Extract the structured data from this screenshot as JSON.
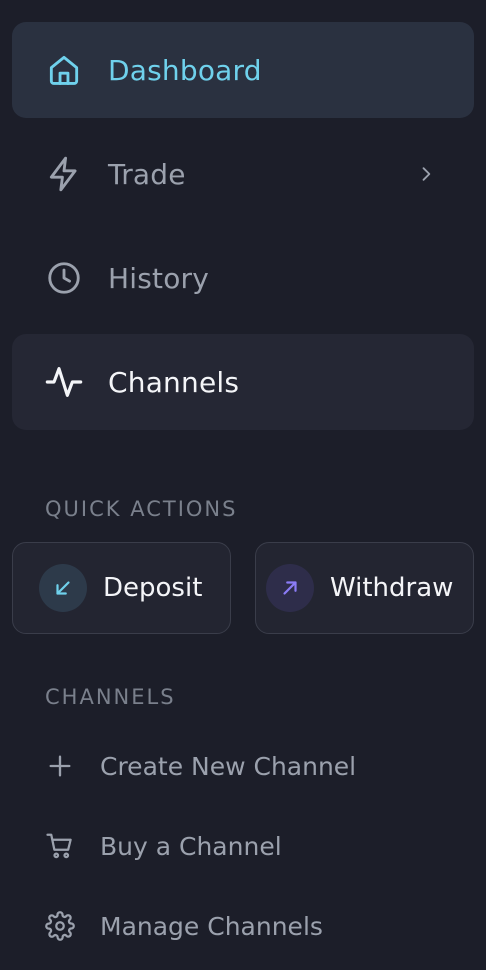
{
  "nav": {
    "dashboard": {
      "label": "Dashboard",
      "icon": "home-icon",
      "active": true,
      "color": "#6fd1ec"
    },
    "trade": {
      "label": "Trade",
      "icon": "lightning-icon",
      "has_submenu": true
    },
    "history": {
      "label": "History",
      "icon": "clock-icon"
    },
    "channels": {
      "label": "Channels",
      "icon": "activity-icon",
      "highlighted": true
    }
  },
  "quick_actions": {
    "heading": "QUICK ACTIONS",
    "deposit": {
      "label": "Deposit",
      "icon": "arrow-down-left-icon",
      "color": "#6fd1ec"
    },
    "withdraw": {
      "label": "Withdraw",
      "icon": "arrow-up-right-icon",
      "color": "#8b7cf6"
    }
  },
  "channels_section": {
    "heading": "CHANNELS",
    "items": [
      {
        "label": "Create New Channel",
        "icon": "plus-icon"
      },
      {
        "label": "Buy a Channel",
        "icon": "cart-icon"
      },
      {
        "label": "Manage Channels",
        "icon": "gear-icon"
      }
    ]
  }
}
